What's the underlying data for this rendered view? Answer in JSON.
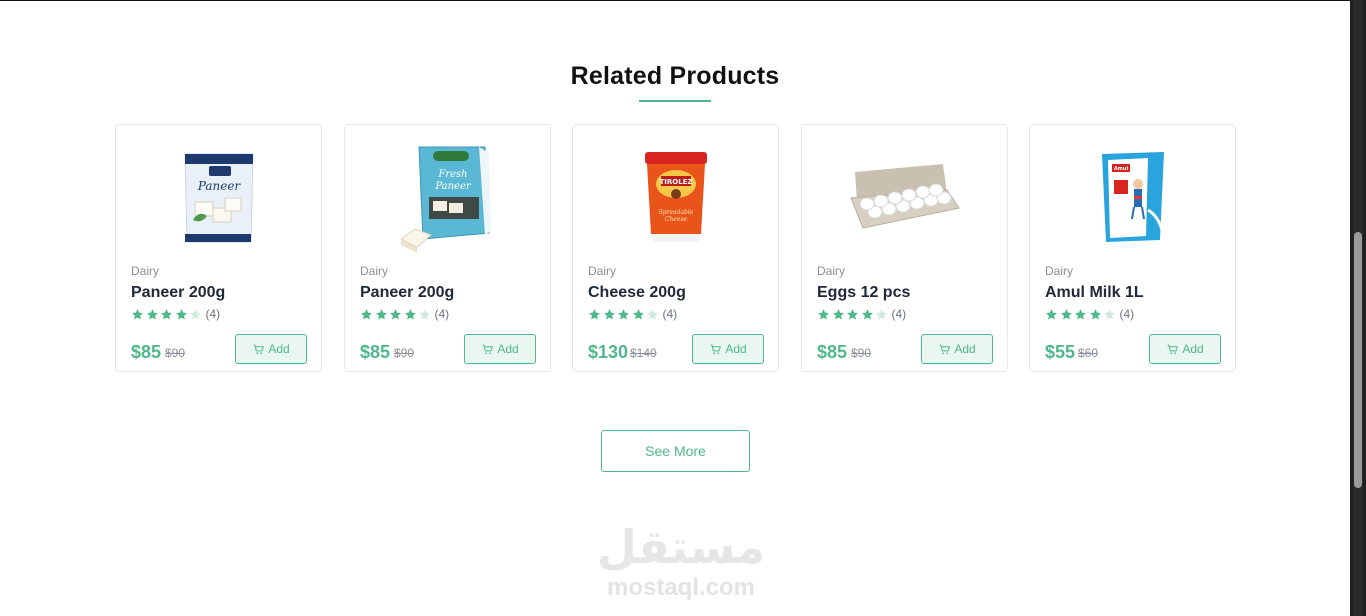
{
  "section": {
    "title": "Related Products",
    "accent_color": "#4fb88a"
  },
  "products": [
    {
      "category": "Dairy",
      "name": "Paneer 200g",
      "rating": 4,
      "rating_max": 5,
      "count": "(4)",
      "price": "$85",
      "old_price": "$90",
      "add_label": "Add",
      "image_icon": "paneer-pack-icon"
    },
    {
      "category": "Dairy",
      "name": "Paneer 200g",
      "rating": 4,
      "rating_max": 5,
      "count": "(4)",
      "price": "$85",
      "old_price": "$90",
      "add_label": "Add",
      "image_icon": "fresh-paneer-pack-icon"
    },
    {
      "category": "Dairy",
      "name": "Cheese 200g",
      "rating": 4,
      "rating_max": 5,
      "count": "(4)",
      "price": "$130",
      "old_price": "$140",
      "add_label": "Add",
      "image_icon": "cheese-tub-icon"
    },
    {
      "category": "Dairy",
      "name": "Eggs 12 pcs",
      "rating": 4,
      "rating_max": 5,
      "count": "(4)",
      "price": "$85",
      "old_price": "$90",
      "add_label": "Add",
      "image_icon": "egg-carton-icon"
    },
    {
      "category": "Dairy",
      "name": "Amul Milk 1L",
      "rating": 4,
      "rating_max": 5,
      "count": "(4)",
      "price": "$55",
      "old_price": "$60",
      "add_label": "Add",
      "image_icon": "milk-pouch-icon"
    }
  ],
  "see_more": {
    "label": "See More"
  },
  "watermark": {
    "arabic": "مستقل",
    "latin": "mostaql.com"
  }
}
